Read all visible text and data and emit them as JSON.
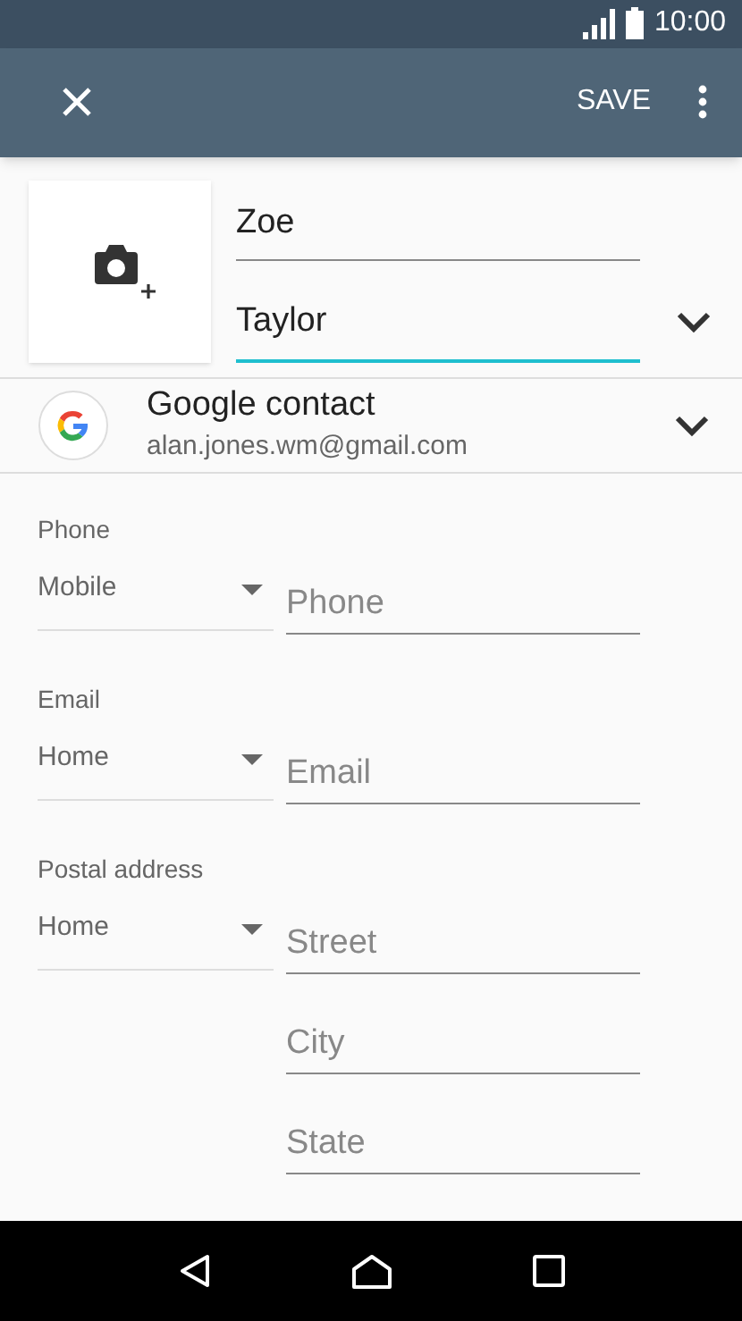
{
  "status_bar": {
    "time": "10:00"
  },
  "toolbar": {
    "save": "SAVE"
  },
  "name_fields": [
    {
      "value": "Zoe",
      "focused": false
    },
    {
      "value": "Taylor",
      "focused": true
    }
  ],
  "account": {
    "title": "Google contact",
    "email": "alan.jones.wm@gmail.com"
  },
  "sections": [
    {
      "label": "Phone",
      "type": "Mobile",
      "fields": [
        {
          "placeholder": "Phone"
        }
      ]
    },
    {
      "label": "Email",
      "type": "Home",
      "fields": [
        {
          "placeholder": "Email"
        }
      ]
    },
    {
      "label": "Postal address",
      "type": "Home",
      "fields": [
        {
          "placeholder": "Street"
        },
        {
          "placeholder": "City"
        },
        {
          "placeholder": "State"
        }
      ]
    }
  ]
}
